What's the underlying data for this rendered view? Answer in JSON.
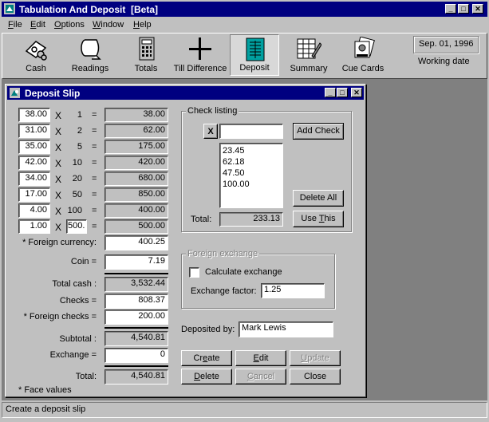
{
  "app": {
    "title": "Tabulation And Deposit  [Beta]",
    "menu": [
      "File",
      "Edit",
      "Options",
      "Window",
      "Help"
    ]
  },
  "toolbar": {
    "buttons": [
      {
        "label": "Cash",
        "icon": "cash-icon"
      },
      {
        "label": "Readings",
        "icon": "readings-icon"
      },
      {
        "label": "Totals",
        "icon": "calculator-icon"
      },
      {
        "label": "Till Difference",
        "icon": "plus-icon"
      },
      {
        "label": "Deposit",
        "icon": "deposit-icon"
      },
      {
        "label": "Summary",
        "icon": "summary-icon"
      },
      {
        "label": "Cue Cards",
        "icon": "cue-cards-icon"
      }
    ],
    "active": "Deposit",
    "date": "Sep. 01, 1996",
    "date_label": "Working date"
  },
  "deposit_slip": {
    "title": "Deposit Slip",
    "rows": [
      {
        "count": "38.00",
        "denom": "1",
        "total": "38.00"
      },
      {
        "count": "31.00",
        "denom": "2",
        "total": "62.00"
      },
      {
        "count": "35.00",
        "denom": "5",
        "total": "175.00"
      },
      {
        "count": "42.00",
        "denom": "10",
        "total": "420.00"
      },
      {
        "count": "34.00",
        "denom": "20",
        "total": "680.00"
      },
      {
        "count": "17.00",
        "denom": "50",
        "total": "850.00"
      },
      {
        "count": "4.00",
        "denom": "100",
        "total": "400.00"
      },
      {
        "count": "1.00",
        "denom": "500.",
        "total": "500.00"
      }
    ],
    "times": "X",
    "equals": "=",
    "foreign_currency_label": "* Foreign currency:",
    "foreign_currency": "400.25",
    "coin_label": "Coin  =",
    "coin": "7.19",
    "total_cash_label": "Total cash :",
    "total_cash": "3,532.44",
    "checks_label": "Checks =",
    "checks": "808.37",
    "foreign_checks_label": "* Foreign checks =",
    "foreign_checks": "200.00",
    "subtotal_label": "Subtotal :",
    "subtotal": "4,540.81",
    "exchange_label": "Exchange =",
    "exchange": "0",
    "total_label": "Total:",
    "total": "4,540.81",
    "face_values_note": "* Face values",
    "check_listing": {
      "label": "Check listing",
      "clear": "X",
      "input_value": "",
      "add_button": "Add Check",
      "items": [
        "23.45",
        "62.18",
        "47.50",
        "100.00"
      ],
      "delete_all": "Delete All",
      "total_label": "Total:",
      "total": "233.13",
      "use_this": "Use This"
    },
    "foreign_exchange": {
      "label": "Foreign exchange",
      "calc_label": "Calculate exchange",
      "calc_checked": false,
      "factor_label": "Exchange factor:",
      "factor": "1.25"
    },
    "deposited_by_label": "Deposited by:",
    "deposited_by": "Mark Lewis",
    "buttons": {
      "create": "Create",
      "edit": "Edit",
      "update": "Update",
      "delete": "Delete",
      "cancel": "Cancel",
      "close": "Close"
    }
  },
  "status": "Create a deposit slip"
}
